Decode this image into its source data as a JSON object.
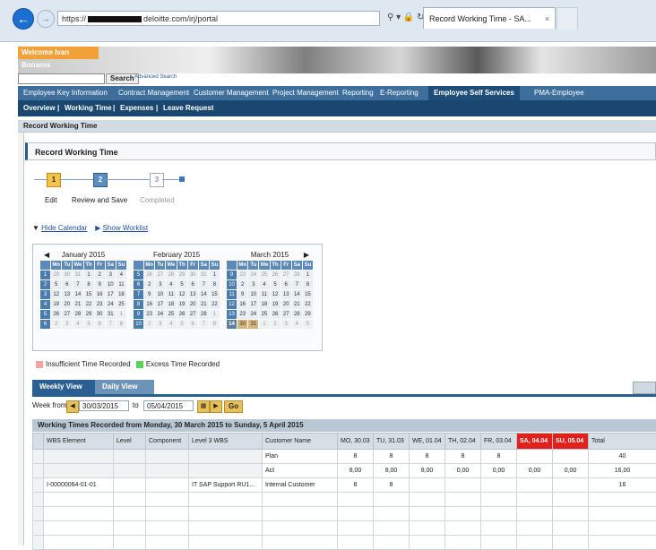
{
  "browser": {
    "url_prefix": "https://",
    "url_host": "deloitte.com/irj/portal",
    "tab_title": "Record Working Time - SA...",
    "tab_close": "×"
  },
  "header": {
    "welcome": "Welcome Ivan Bonaros",
    "search_button": "Search",
    "advanced_search": "Advanced Search"
  },
  "nav_top": [
    "Employee Key Information",
    "Contract Management",
    "Customer Management",
    "Project Management",
    "Reporting",
    "E-Reporting",
    "Employee Self Services",
    "PMA-Employee"
  ],
  "nav_top_active": "Employee Self Services",
  "nav_sub": [
    "Overview",
    "Working Time",
    "Expenses",
    "Leave Request"
  ],
  "breadcrumb": "Record Working Time",
  "panel_title": "Record Working Time",
  "roadmap": {
    "steps": [
      {
        "num": "1",
        "label": "Edit"
      },
      {
        "num": "2",
        "label": "Review and Save"
      },
      {
        "num": "3",
        "label": "Completed"
      }
    ]
  },
  "links": {
    "hide_calendar": "Hide Calendar",
    "show_worklist": "Show Worklist"
  },
  "calendar": {
    "day_headers": [
      "",
      "Mo",
      "Tu",
      "We",
      "Th",
      "Fr",
      "Sa",
      "Su"
    ],
    "months": [
      {
        "name": "January 2015",
        "weeks": [
          [
            "1",
            "29",
            "30",
            "31",
            "1",
            "2",
            "3",
            "4"
          ],
          [
            "2",
            "5",
            "6",
            "7",
            "8",
            "9",
            "10",
            "11"
          ],
          [
            "3",
            "12",
            "13",
            "14",
            "15",
            "16",
            "17",
            "18"
          ],
          [
            "4",
            "19",
            "20",
            "21",
            "22",
            "23",
            "24",
            "25"
          ],
          [
            "5",
            "26",
            "27",
            "28",
            "29",
            "30",
            "31",
            "1"
          ],
          [
            "6",
            "2",
            "3",
            "4",
            "5",
            "6",
            "7",
            "8"
          ]
        ]
      },
      {
        "name": "February 2015",
        "weeks": [
          [
            "5",
            "26",
            "27",
            "28",
            "29",
            "30",
            "31",
            "1"
          ],
          [
            "6",
            "2",
            "3",
            "4",
            "5",
            "6",
            "7",
            "8"
          ],
          [
            "7",
            "9",
            "10",
            "11",
            "12",
            "13",
            "14",
            "15"
          ],
          [
            "8",
            "16",
            "17",
            "18",
            "19",
            "20",
            "21",
            "22"
          ],
          [
            "9",
            "23",
            "24",
            "25",
            "26",
            "27",
            "28",
            "1"
          ],
          [
            "10",
            "2",
            "3",
            "4",
            "5",
            "6",
            "7",
            "8"
          ]
        ]
      },
      {
        "name": "March 2015",
        "weeks": [
          [
            "9",
            "23",
            "24",
            "25",
            "26",
            "27",
            "28",
            "1"
          ],
          [
            "10",
            "2",
            "3",
            "4",
            "5",
            "6",
            "7",
            "8"
          ],
          [
            "11",
            "9",
            "10",
            "11",
            "12",
            "13",
            "14",
            "15"
          ],
          [
            "12",
            "16",
            "17",
            "18",
            "19",
            "20",
            "21",
            "22"
          ],
          [
            "13",
            "23",
            "24",
            "25",
            "26",
            "27",
            "28",
            "29"
          ],
          [
            "14",
            "30",
            "31",
            "1",
            "2",
            "3",
            "4",
            "5"
          ]
        ]
      }
    ]
  },
  "legend": {
    "insufficient": "Insufficient Time Recorded",
    "excess": "Excess Time Recorded"
  },
  "view_tabs": [
    "Weekly View",
    "Daily View"
  ],
  "week": {
    "label": "Week from",
    "from": "30/03/2015",
    "to_label": "to",
    "to": "05/04/2015",
    "go": "Go"
  },
  "table": {
    "caption": "Working Times Recorded from Monday, 30 March 2015 to Sunday, 5 April 2015",
    "headers": [
      "",
      "WBS Element",
      "Level",
      "Component",
      "Level 3 WBS",
      "Customer Name",
      "MO, 30.03",
      "TU, 31.03",
      "WE, 01.04",
      "TH, 02.04",
      "FR, 03.04",
      "SA, 04.04",
      "SU, 05.04",
      "Total"
    ],
    "rows": [
      [
        "",
        "",
        "",
        "",
        "",
        "Plan",
        "8",
        "8",
        "8",
        "8",
        "8",
        "",
        "",
        "40"
      ],
      [
        "",
        "",
        "",
        "",
        "",
        "Act",
        "8,00",
        "8,00",
        "8,00",
        "0,00",
        "0,00",
        "0,00",
        "0,00",
        "16,00"
      ],
      [
        "",
        "I-00000064-01-01",
        "",
        "",
        "IT SAP Support RU1...",
        "Internal Customer",
        "8",
        "8",
        "",
        "",
        "",
        "",
        "",
        "16"
      ],
      [
        "",
        "",
        "",
        "",
        "",
        "",
        "",
        "",
        "",
        "",
        "",
        "",
        "",
        ""
      ],
      [
        "",
        "",
        "",
        "",
        "",
        "",
        "",
        "",
        "",
        "",
        "",
        "",
        "",
        ""
      ],
      [
        "",
        "",
        "",
        "",
        "",
        "",
        "",
        "",
        "",
        "",
        "",
        "",
        "",
        ""
      ],
      [
        "",
        "",
        "",
        "",
        "",
        "",
        "",
        "",
        "",
        "",
        "",
        "",
        "",
        ""
      ]
    ]
  },
  "colors": {
    "insufficient": "#f4a3a3",
    "excess": "#5bd35b",
    "weekend_header": "#e0201b"
  }
}
